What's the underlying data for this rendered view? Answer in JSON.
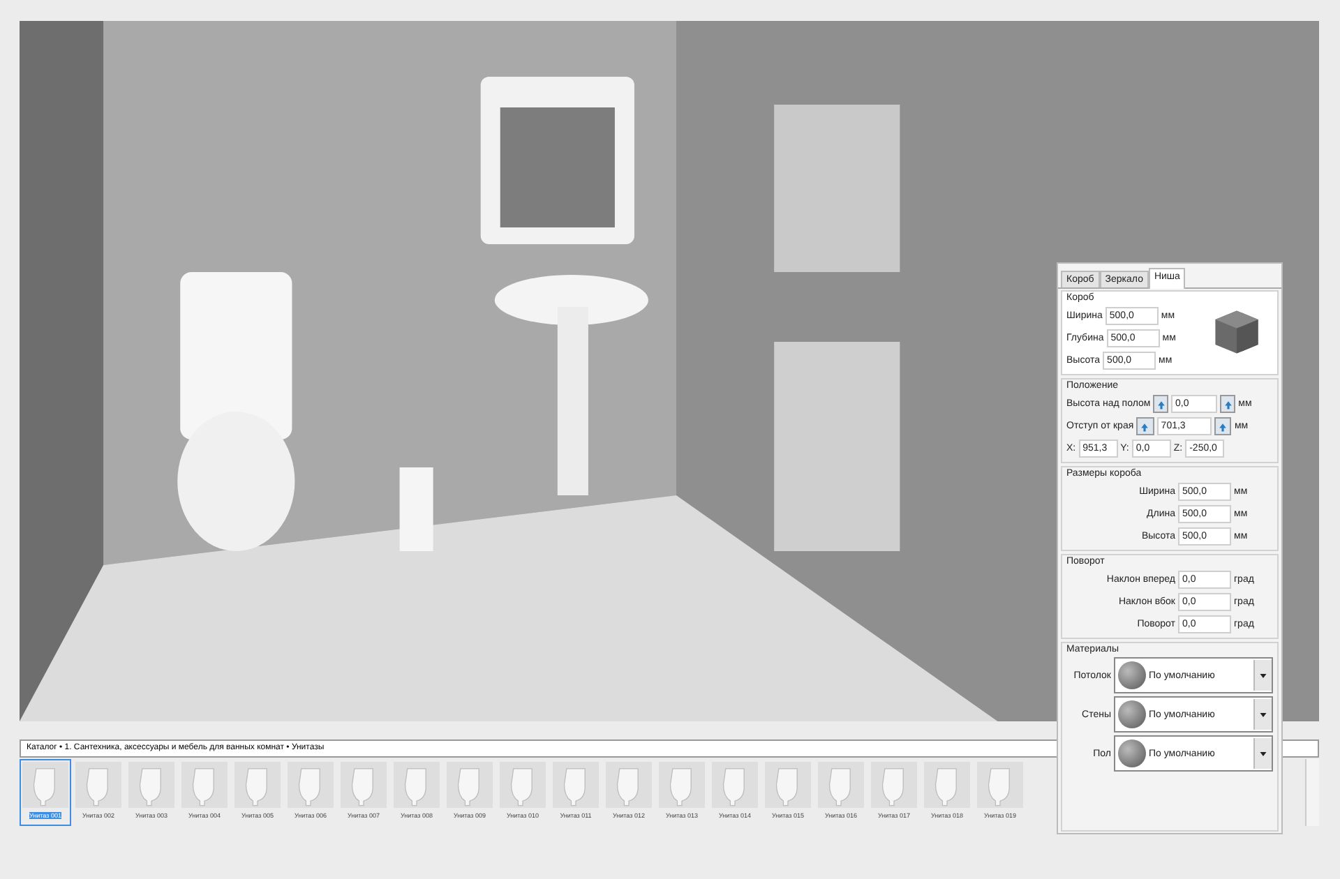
{
  "panel": {
    "tabs": [
      {
        "label": "Короб",
        "selected": false
      },
      {
        "label": "Зеркало",
        "selected": false
      },
      {
        "label": "Ниша",
        "selected": true
      }
    ],
    "box_group": {
      "title": "Короб",
      "fields": [
        {
          "label": "Ширина",
          "value": "500,0",
          "unit": "мм"
        },
        {
          "label": "Глубина",
          "value": "500,0",
          "unit": "мм"
        },
        {
          "label": "Высота",
          "value": "500,0",
          "unit": "мм"
        }
      ]
    },
    "position": {
      "title": "Положение",
      "offsets": [
        {
          "label": "Высота над полом",
          "value": "0,0",
          "unit": "мм"
        },
        {
          "label": "Отступ от края",
          "value": "701,3",
          "unit": "мм"
        }
      ],
      "coords": [
        {
          "label": "X:",
          "value": "951,3"
        },
        {
          "label": "Y:",
          "value": "0,0"
        },
        {
          "label": "Z:",
          "value": "-250,0"
        }
      ]
    },
    "sections": [
      {
        "title": "Размеры короба",
        "fields": [
          {
            "label": "Ширина",
            "value": "500,0",
            "unit": "мм"
          },
          {
            "label": "Длина",
            "value": "500,0",
            "unit": "мм"
          },
          {
            "label": "Высота",
            "value": "500,0",
            "unit": "мм"
          }
        ]
      },
      {
        "title": "Поворот",
        "fields": [
          {
            "label": "Наклон вперед",
            "value": "0,0",
            "unit": "град"
          },
          {
            "label": "Наклон вбок",
            "value": "0,0",
            "unit": "град"
          },
          {
            "label": "Поворот",
            "value": "0,0",
            "unit": "град"
          }
        ]
      }
    ],
    "materials": {
      "title": "Материалы",
      "items": [
        {
          "label": "Потолок",
          "value": "По умолчанию"
        },
        {
          "label": "Стены",
          "value": "По умолчанию"
        },
        {
          "label": "Пол",
          "value": "По умолчанию"
        }
      ]
    }
  },
  "catalog": {
    "breadcrumb": "Каталог • 1. Сантехника, аксессуары и мебель для ванных комнат • Унитазы",
    "items": [
      {
        "label": "Унитаз 001",
        "selected": true
      },
      {
        "label": "Унитаз 002",
        "selected": false
      },
      {
        "label": "Унитаз 003",
        "selected": false
      },
      {
        "label": "Унитаз 004",
        "selected": false
      },
      {
        "label": "Унитаз 005",
        "selected": false
      },
      {
        "label": "Унитаз 006",
        "selected": false
      },
      {
        "label": "Унитаз 007",
        "selected": false
      },
      {
        "label": "Унитаз 008",
        "selected": false
      },
      {
        "label": "Унитаз 009",
        "selected": false
      },
      {
        "label": "Унитаз 010",
        "selected": false
      },
      {
        "label": "Унитаз 011",
        "selected": false
      },
      {
        "label": "Унитаз 012",
        "selected": false
      },
      {
        "label": "Унитаз 013",
        "selected": false
      },
      {
        "label": "Унитаз 014",
        "selected": false
      },
      {
        "label": "Унитаз 015",
        "selected": false
      },
      {
        "label": "Унитаз 016",
        "selected": false
      },
      {
        "label": "Унитаз 017",
        "selected": false
      },
      {
        "label": "Унитаз 018",
        "selected": false
      },
      {
        "label": "Унитаз 019",
        "selected": false
      }
    ]
  }
}
